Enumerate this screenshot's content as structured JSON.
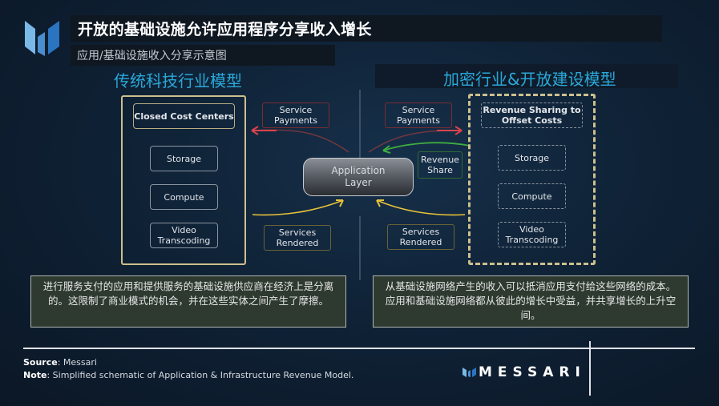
{
  "header": {
    "title": "开放的基础设施允许应用程序分享收入增长",
    "subtitle": "应用/基础设施收入分享示意图"
  },
  "sections": {
    "left_title": "传统科技行业模型",
    "right_title": "加密行业&开放建设模型"
  },
  "left_model": {
    "header": "Closed Cost Centers",
    "items": [
      "Storage",
      "Compute",
      "Video Transcoding"
    ]
  },
  "right_model": {
    "header": "Revenue Sharing to Offset Costs",
    "items": [
      "Storage",
      "Compute",
      "Video Transcoding"
    ]
  },
  "center": {
    "app_layer": "Application Layer",
    "left_payments": "Service Payments",
    "right_payments": "Service Payments",
    "revenue_share": "Revenue Share",
    "left_rendered": "Services Rendered",
    "right_rendered": "Services Rendered"
  },
  "descriptions": {
    "left": "进行服务支付的应用和提供服务的基础设施供应商在经济上是分离的。这限制了商业模式的机会，并在这些实体之间产生了摩擦。",
    "right": "从基础设施网络产生的收入可以抵消应用支付给这些网络的成本。应用和基础设施网络都从彼此的增长中受益，并共享增长的上升空间。"
  },
  "footer": {
    "source_label": "Source",
    "source_value": ": Messari",
    "note_label": "Note",
    "note_value": ": Simplified schematic of Application & Infrastructure Revenue Model.",
    "brand": "MESSARI"
  },
  "colors": {
    "accent_blue": "#2aa8d8",
    "payment_red": "#d9434a",
    "revenue_green": "#3fae3f",
    "rendered_yellow": "#e8c23a",
    "gold_border": "#cdbf8d"
  }
}
